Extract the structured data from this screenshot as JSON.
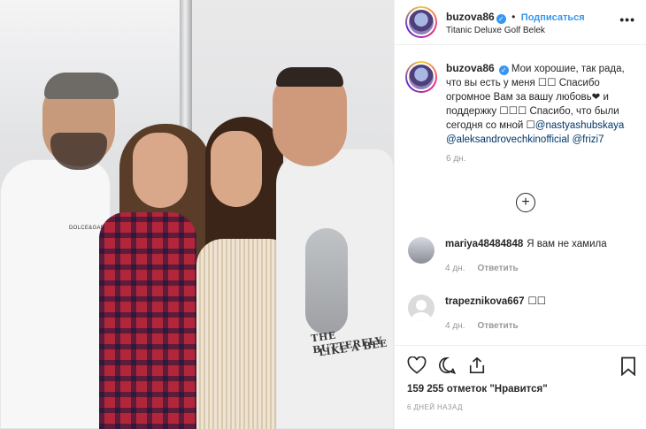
{
  "post": {
    "username": "buzova86",
    "follow_label": "Подписаться",
    "dot": "•",
    "location": "Titanic Deluxe Golf Belek",
    "more": "•••",
    "verified_mark": "✓"
  },
  "caption": {
    "username": "buzova86",
    "text_1": "Мои хорошие, так рада, что вы есть у меня ☐☐ Спасибо огромное Вам за вашу любовь",
    "heart": "❤",
    "text_2": " и поддержку ☐☐☐ Спасибо, что были сегодня со мной ☐",
    "mentions": "@nastyashubskaya @aleksandrovechkinofficial @frizi7",
    "time": "6 дн."
  },
  "load_more_icon": "plus-circle-icon",
  "comments": [
    {
      "username": "mariya48484848",
      "text": "Я вам не хамила",
      "time": "4 дн.",
      "reply": "Ответить"
    },
    {
      "username": "trapeznikova667",
      "text": "☐☐",
      "time": "4 дн.",
      "reply": "Ответить"
    }
  ],
  "footer": {
    "likes": "159 255 отметок \"Нравится\"",
    "posted": "6 ДНЕЙ НАЗАД"
  },
  "photo": {
    "shirt_text": "THE BUTTERFLY",
    "shirt_text_2": "LIKE A BEE",
    "shirt_logo": "DOLCE&GABBANA"
  }
}
